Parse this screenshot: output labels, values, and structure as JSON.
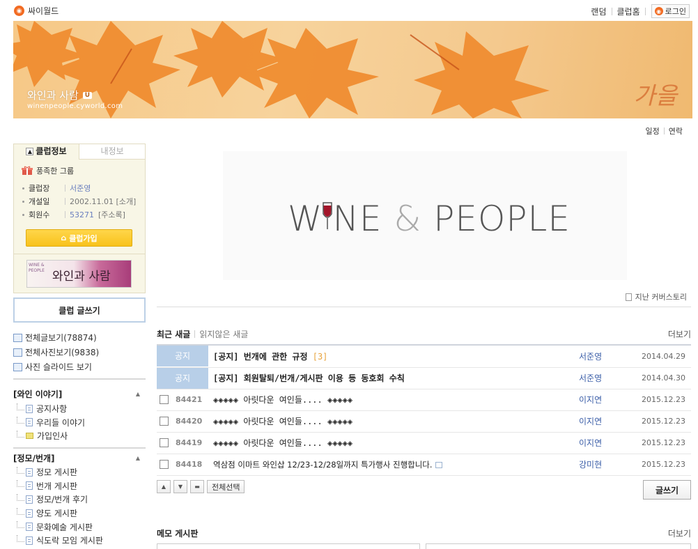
{
  "topbar": {
    "brand": "싸이월드",
    "links": [
      "랜덤",
      "클럽홈"
    ],
    "login_label": "로그인"
  },
  "banner": {
    "title": "와인과 사람",
    "badge": "U",
    "url": "winenpeople.cyworld.com",
    "season_text": "가을"
  },
  "sublinks": [
    "일정",
    "연락"
  ],
  "club_info": {
    "tab_active": "클럽정보",
    "tab_inactive": "내정보",
    "grade": "풍족한 그룹",
    "rows": [
      {
        "key": "클럽장",
        "value": "서준영"
      },
      {
        "key": "개설일",
        "value": "2002.11.01 [소개]"
      },
      {
        "key": "회원수",
        "value_num": "53271",
        "value_suffix": "[주소록]"
      }
    ],
    "join_label": "클럽가입",
    "mini_banner_en": "WINE & PEOPLE",
    "mini_banner_kr": "와인과 사람"
  },
  "write_button": "클럽 글쓰기",
  "view_links": [
    "전체글보기(78874)",
    "전체사진보기(9838)",
    "사진 슬라이드 보기"
  ],
  "categories": [
    {
      "title": "[와인 이야기]",
      "items": [
        "공지사항",
        "우리들 이야기",
        "가입인사"
      ]
    },
    {
      "title": "[정모/번개]",
      "items": [
        "정모 게시판",
        "번개 게시판",
        "정모/번개 후기",
        "양도 게시판",
        "문화예술 게시판",
        "식도락 모임 게시판"
      ]
    }
  ],
  "cover": {
    "logo_left": "W",
    "logo_mid": "NE",
    "logo_amp": "&",
    "logo_right": "PEOPLE",
    "past_label": "지난 커버스토리"
  },
  "new_posts": {
    "tab_active": "최근 새글",
    "tab_inactive": "읽지않은 새글",
    "more": "더보기",
    "notice_label": "공지",
    "posts": [
      {
        "num": "공지",
        "title": "[공지] 번개에 관한 규정",
        "comments": "[3]",
        "author": "서준영",
        "date": "2014.04.29"
      },
      {
        "num": "공지",
        "title": "[공지] 회원탈퇴/번개/게시판 이용 등 동호회 수칙",
        "comments": "",
        "author": "서준영",
        "date": "2014.04.30"
      },
      {
        "num": "84421",
        "title": "◈◈◈◈◈ 아릿다운 여인들.... ◈◈◈◈◈",
        "comments": "",
        "author": "이지연",
        "date": "2015.12.23"
      },
      {
        "num": "84420",
        "title": "◈◈◈◈◈ 아릿다운 여인들.... ◈◈◈◈◈",
        "comments": "",
        "author": "이지연",
        "date": "2015.12.23"
      },
      {
        "num": "84419",
        "title": "◈◈◈◈◈ 아릿다운 여인들.... ◈◈◈◈◈",
        "comments": "",
        "author": "이지연",
        "date": "2015.12.23"
      },
      {
        "num": "84418",
        "title": "역삼점 이마트 와인샵 12/23-12/28일까지 특가행사 진행합니다.",
        "comments": "",
        "author": "강미현",
        "date": "2015.12.23"
      }
    ],
    "select_all": "전체선택",
    "write_label": "글쓰기"
  },
  "memo": {
    "title": "메모 게시판",
    "more": "더보기"
  }
}
